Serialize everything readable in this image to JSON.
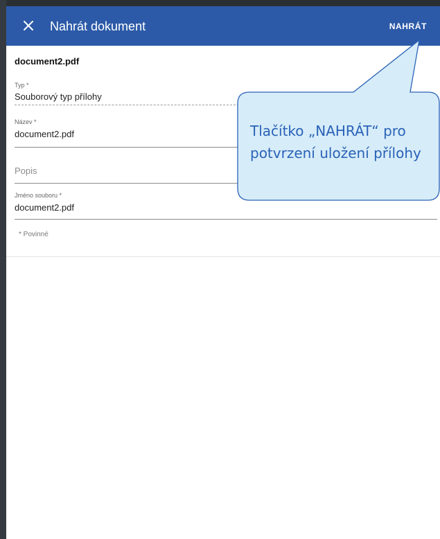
{
  "appbar": {
    "title": "Nahrát dokument",
    "upload_label": "NAHRÁT",
    "bg_color": "#2c5aa8"
  },
  "document": {
    "filename_heading": "document2.pdf"
  },
  "form": {
    "type": {
      "label": "Typ *",
      "value": "Souborový typ přílohy"
    },
    "name": {
      "label": "Název *",
      "value": "document2.pdf"
    },
    "description": {
      "placeholder": "Popis"
    },
    "file_name": {
      "label": "Jméno souboru *",
      "value": "document2.pdf"
    },
    "required_note": "* Povinné"
  },
  "callout": {
    "text": "Tlačítko „NAHRÁT“ pro potvrzení uložení přílohy",
    "fill_color": "#d6ecf8",
    "border_color": "#2a62b8"
  },
  "icons": {
    "close": "close-icon"
  }
}
